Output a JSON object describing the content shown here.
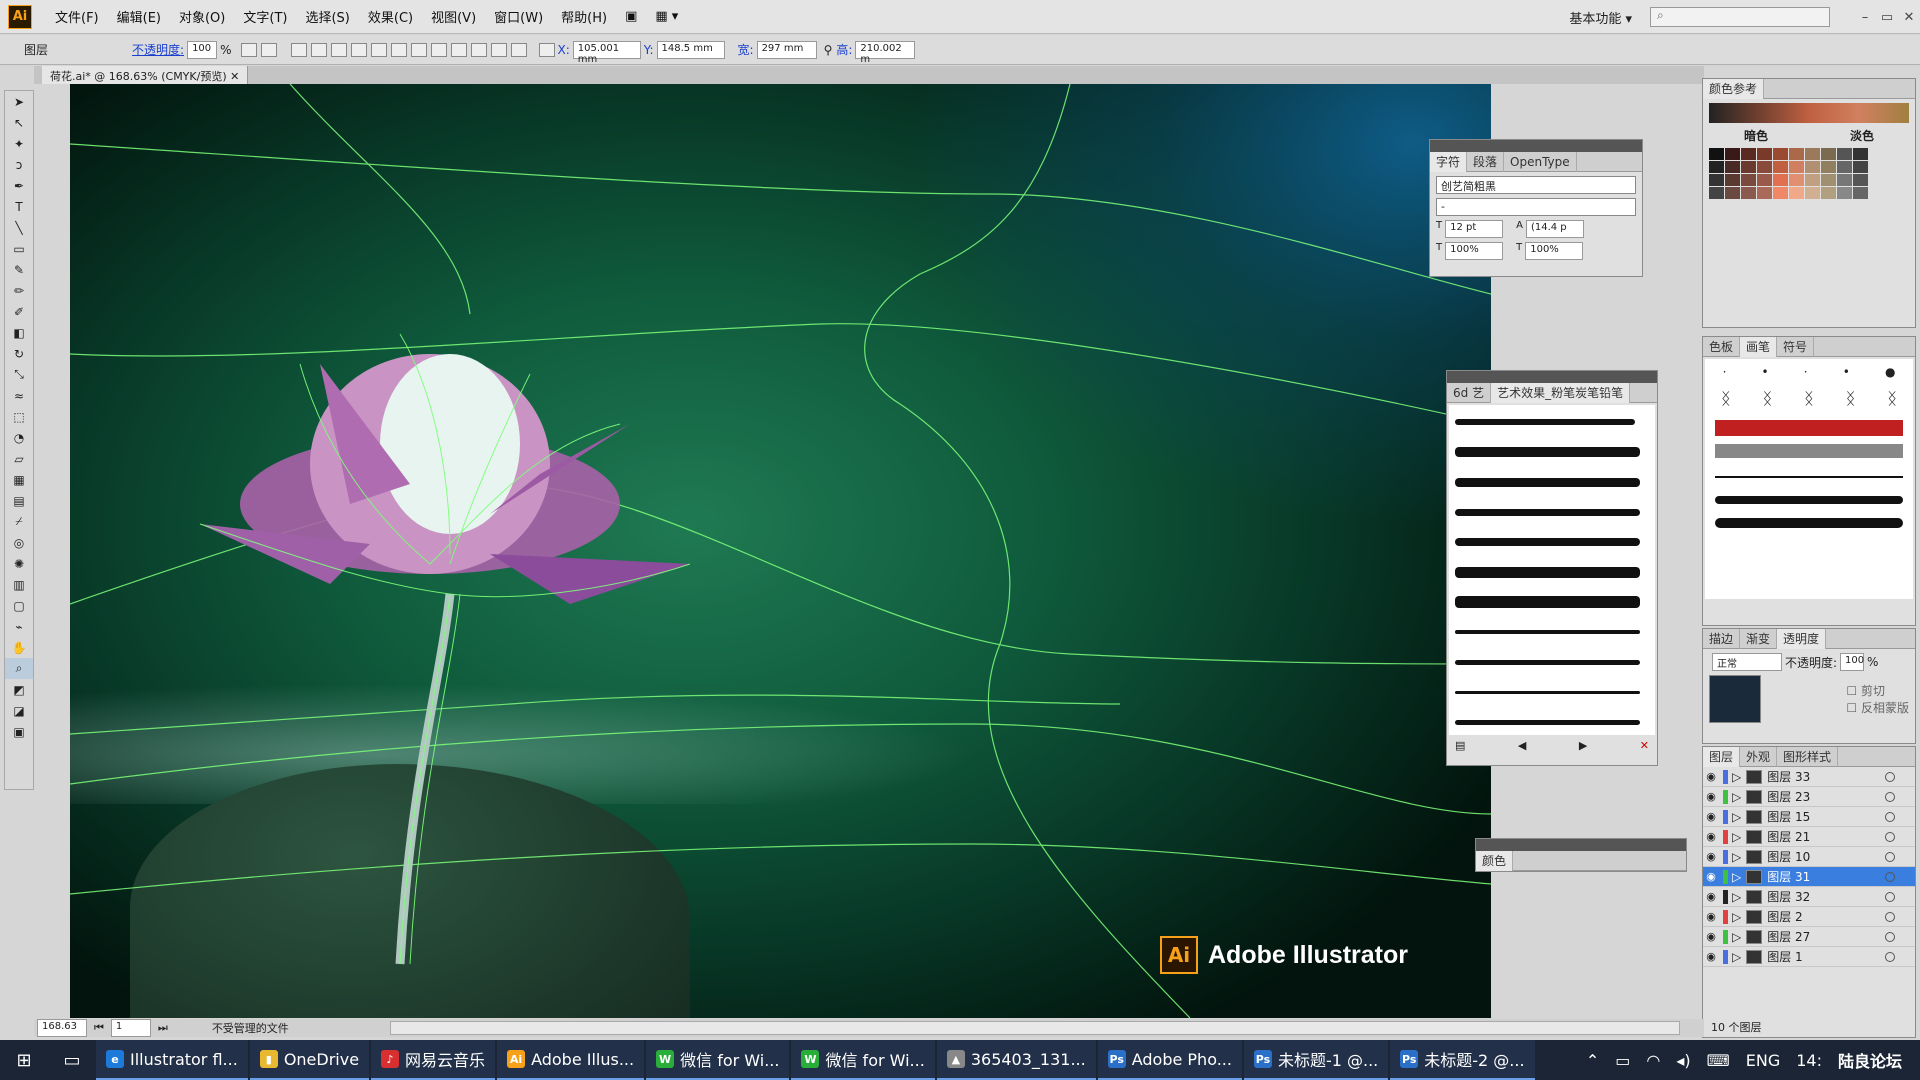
{
  "menubar": {
    "logo": "Ai",
    "items": [
      "文件(F)",
      "编辑(E)",
      "对象(O)",
      "文字(T)",
      "选择(S)",
      "效果(C)",
      "视图(V)",
      "窗口(W)",
      "帮助(H)"
    ],
    "workspace": "基本功能",
    "window_controls": [
      "–",
      "▭",
      "✕"
    ]
  },
  "controlbar": {
    "selection_label": "图层",
    "opacity_label": "不透明度:",
    "opacity_value": "100",
    "opacity_unit": "%",
    "x_label": "X:",
    "x_value": "105.001 mm",
    "y_label": "Y:",
    "y_value": "148.5 mm",
    "w_label": "宽:",
    "w_value": "297 mm",
    "h_label": "高:",
    "h_value": "210.002 m"
  },
  "document": {
    "tab_title": "荷花.ai* @ 168.63% (CMYK/预览)",
    "watermark_logo": "Ai",
    "watermark_text": "Adobe Illustrator"
  },
  "character_panel": {
    "tabs": [
      "字符",
      "段落",
      "OpenType"
    ],
    "font_family": "创艺简粗黑",
    "font_style": "-",
    "font_size": "12 pt",
    "leading": "(14.4 p",
    "vscale": "100%",
    "hscale": "100%"
  },
  "brush_library_panel": {
    "tab_prefix": "6d 艺",
    "tab_title": "艺术效果_粉笔炭笔铅笔"
  },
  "color_panel": {
    "title": "颜色"
  },
  "color_guide_panel": {
    "title": "颜色参考",
    "shade_label": "暗色",
    "tint_label": "淡色"
  },
  "swatches_panel": {
    "tabs": [
      "色板",
      "画笔",
      "符号"
    ]
  },
  "transparency_panel": {
    "tabs": [
      "描边",
      "渐变",
      "透明度"
    ],
    "blend_mode": "正常",
    "opacity_label": "不透明度:",
    "opacity_value": "100",
    "opacity_unit": "%",
    "clip_label": "剪切",
    "invert_label": "反相蒙版"
  },
  "layers_panel": {
    "tabs": [
      "图层",
      "外观",
      "图形样式"
    ],
    "layers": [
      {
        "name": "图层 33",
        "color": "#4a6ee0",
        "selected": false
      },
      {
        "name": "图层 23",
        "color": "#3ec040",
        "selected": false
      },
      {
        "name": "图层 15",
        "color": "#4a6ee0",
        "selected": false
      },
      {
        "name": "图层 21",
        "color": "#e04040",
        "selected": false
      },
      {
        "name": "图层 10",
        "color": "#4a6ee0",
        "selected": false
      },
      {
        "name": "图层 31",
        "color": "#3ec040",
        "selected": true
      },
      {
        "name": "图层 32",
        "color": "#222222",
        "selected": false
      },
      {
        "name": "图层 2",
        "color": "#e04040",
        "selected": false
      },
      {
        "name": "图层 27",
        "color": "#3ec040",
        "selected": false
      },
      {
        "name": "图层 1",
        "color": "#4a6ee0",
        "selected": false
      }
    ],
    "count": "10 个图层"
  },
  "statusbar": {
    "zoom": "168.63",
    "artboard": "1",
    "status": "不受管理的文件"
  },
  "taskbar": {
    "items": [
      {
        "label": "Illustrator fl...",
        "icon": "e",
        "color": "#1e7ad8"
      },
      {
        "label": "OneDrive",
        "icon": "▮",
        "color": "#e8b830"
      },
      {
        "label": "网易云音乐",
        "icon": "♪",
        "color": "#d83030"
      },
      {
        "label": "Adobe Illus...",
        "icon": "Ai",
        "color": "#f7a11b"
      },
      {
        "label": "微信 for Wi...",
        "icon": "W",
        "color": "#2aae3a"
      },
      {
        "label": "微信 for Wi...",
        "icon": "W",
        "color": "#2aae3a"
      },
      {
        "label": "365403_131...",
        "icon": "▲",
        "color": "#888888"
      },
      {
        "label": "Adobe Pho...",
        "icon": "Ps",
        "color": "#2a70c8"
      },
      {
        "label": "未标题-1 @...",
        "icon": "Ps",
        "color": "#2a70c8"
      },
      {
        "label": "未标题-2 @...",
        "icon": "Ps",
        "color": "#2a70c8"
      }
    ],
    "lang": "ENG",
    "time": "14:",
    "watermark": "陆良论坛"
  }
}
